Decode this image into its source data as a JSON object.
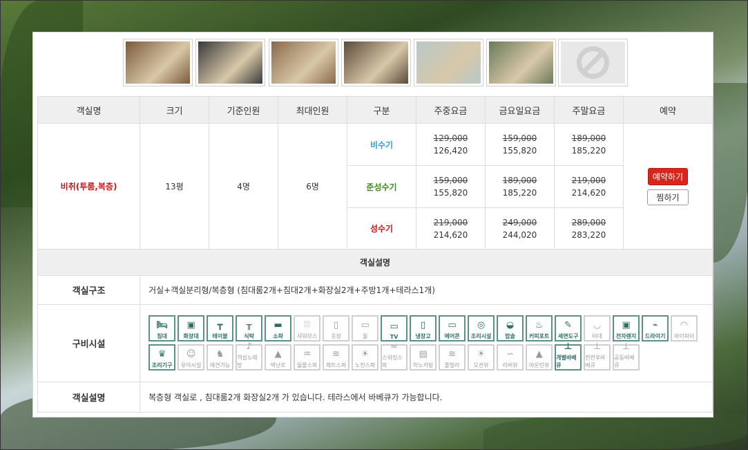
{
  "thumbnails": [
    {
      "icon": "photo-icon",
      "color": "#7a5a3a"
    },
    {
      "icon": "photo-icon",
      "color": "#3a3a3a"
    },
    {
      "icon": "photo-icon",
      "color": "#8a6a4a"
    },
    {
      "icon": "photo-icon",
      "color": "#5a4a3a"
    },
    {
      "icon": "photo-icon",
      "color": "#b7c9c9"
    },
    {
      "icon": "photo-icon",
      "color": "#6a7a5a"
    },
    {
      "icon": "no-image-icon",
      "color": "#e8e8e8"
    }
  ],
  "table": {
    "headers": [
      "객실명",
      "크기",
      "기준인원",
      "최대인원",
      "구분",
      "주중요금",
      "금요일요금",
      "주말요금",
      "예약"
    ],
    "room_name": "비취(투룸,복층)",
    "size": "13평",
    "base_people": "4명",
    "max_people": "6명",
    "seasons": [
      {
        "name": "비수기",
        "weekday_old": "129,000",
        "weekday_new": "126,420",
        "friday_old": "159,000",
        "friday_new": "155,820",
        "weekend_old": "189,000",
        "weekend_new": "185,220"
      },
      {
        "name": "준성수기",
        "weekday_old": "159,000",
        "weekday_new": "155,820",
        "friday_old": "189,000",
        "friday_new": "185,220",
        "weekend_old": "219,000",
        "weekend_new": "214,620"
      },
      {
        "name": "성수기",
        "weekday_old": "219,000",
        "weekday_new": "214,620",
        "friday_old": "249,000",
        "friday_new": "244,020",
        "weekend_old": "289,000",
        "weekend_new": "283,220"
      }
    ],
    "reserve_label": "예약하기",
    "wish_label": "찜하기"
  },
  "description": {
    "section_title": "객실설명",
    "structure_label": "객실구조",
    "structure_value": "거실+객실분리형/복층형 (침대룸2개+침대2개+화장실2개+주방1개+테라스1개)",
    "amenities_label": "구비시설",
    "desc_label": "객실설명",
    "desc_value": "복층형 객실로 , 침대룸2개 화장실2개 가 있습니다. 테라스에서 바베큐가 가능합니다."
  },
  "amenities": [
    {
      "label": "침대",
      "icon": "bed-icon",
      "active": true
    },
    {
      "label": "화장대",
      "icon": "vanity-icon",
      "active": true
    },
    {
      "label": "테이블",
      "icon": "table-icon",
      "active": true
    },
    {
      "label": "식탁",
      "icon": "dining-table-icon",
      "active": true
    },
    {
      "label": "소파",
      "icon": "sofa-icon",
      "active": true
    },
    {
      "label": "샤워부스",
      "icon": "shower-icon",
      "active": false
    },
    {
      "label": "옷장",
      "icon": "wardrobe-icon",
      "active": false
    },
    {
      "label": "월",
      "icon": "wall-icon",
      "active": false
    },
    {
      "label": "TV",
      "icon": "tv-icon",
      "active": true
    },
    {
      "label": "냉장고",
      "icon": "fridge-icon",
      "active": true
    },
    {
      "label": "에어콘",
      "icon": "aircon-icon",
      "active": true
    },
    {
      "label": "조리시설",
      "icon": "stove-icon",
      "active": true
    },
    {
      "label": "밥솥",
      "icon": "rice-cooker-icon",
      "active": true
    },
    {
      "label": "커피포트",
      "icon": "kettle-icon",
      "active": true
    },
    {
      "label": "세면도구",
      "icon": "toiletries-icon",
      "active": true
    },
    {
      "label": "비데",
      "icon": "bidet-icon",
      "active": false
    },
    {
      "label": "전자렌지",
      "icon": "microwave-icon",
      "active": true
    },
    {
      "label": "드라이기",
      "icon": "hair-dryer-icon",
      "active": true
    },
    {
      "label": "와이파이",
      "icon": "wifi-icon",
      "active": false
    },
    {
      "label": "조리기구",
      "icon": "cookware-icon",
      "active": true
    },
    {
      "label": "유아시설",
      "icon": "kids-icon",
      "active": false
    },
    {
      "label": "애견가능",
      "icon": "pet-icon",
      "active": false
    },
    {
      "label": "객실노래방",
      "icon": "karaoke-icon",
      "active": false
    },
    {
      "label": "벽난로",
      "icon": "fireplace-icon",
      "active": false
    },
    {
      "label": "월풀스파",
      "icon": "whirlpool-icon",
      "active": false
    },
    {
      "label": "제트스파",
      "icon": "jet-spa-icon",
      "active": false
    },
    {
      "label": "노천스파",
      "icon": "outdoor-spa-icon",
      "active": false
    },
    {
      "label": "스위밍스파",
      "icon": "swim-spa-icon",
      "active": false
    },
    {
      "label": "히노키탕",
      "icon": "hinoki-bath-icon",
      "active": false
    },
    {
      "label": "풀빌라",
      "icon": "pool-villa-icon",
      "active": false
    },
    {
      "label": "오션뷰",
      "icon": "ocean-view-icon",
      "active": false
    },
    {
      "label": "리버뷰",
      "icon": "river-view-icon",
      "active": false
    },
    {
      "label": "마운틴뷰",
      "icon": "mountain-view-icon",
      "active": false
    },
    {
      "label": "개별바베큐",
      "icon": "private-bbq-icon",
      "active": true
    },
    {
      "label": "전전후바베큐",
      "icon": "bbq-icon",
      "active": false
    },
    {
      "label": "공동바베큐",
      "icon": "shared-bbq-icon",
      "active": false
    }
  ]
}
